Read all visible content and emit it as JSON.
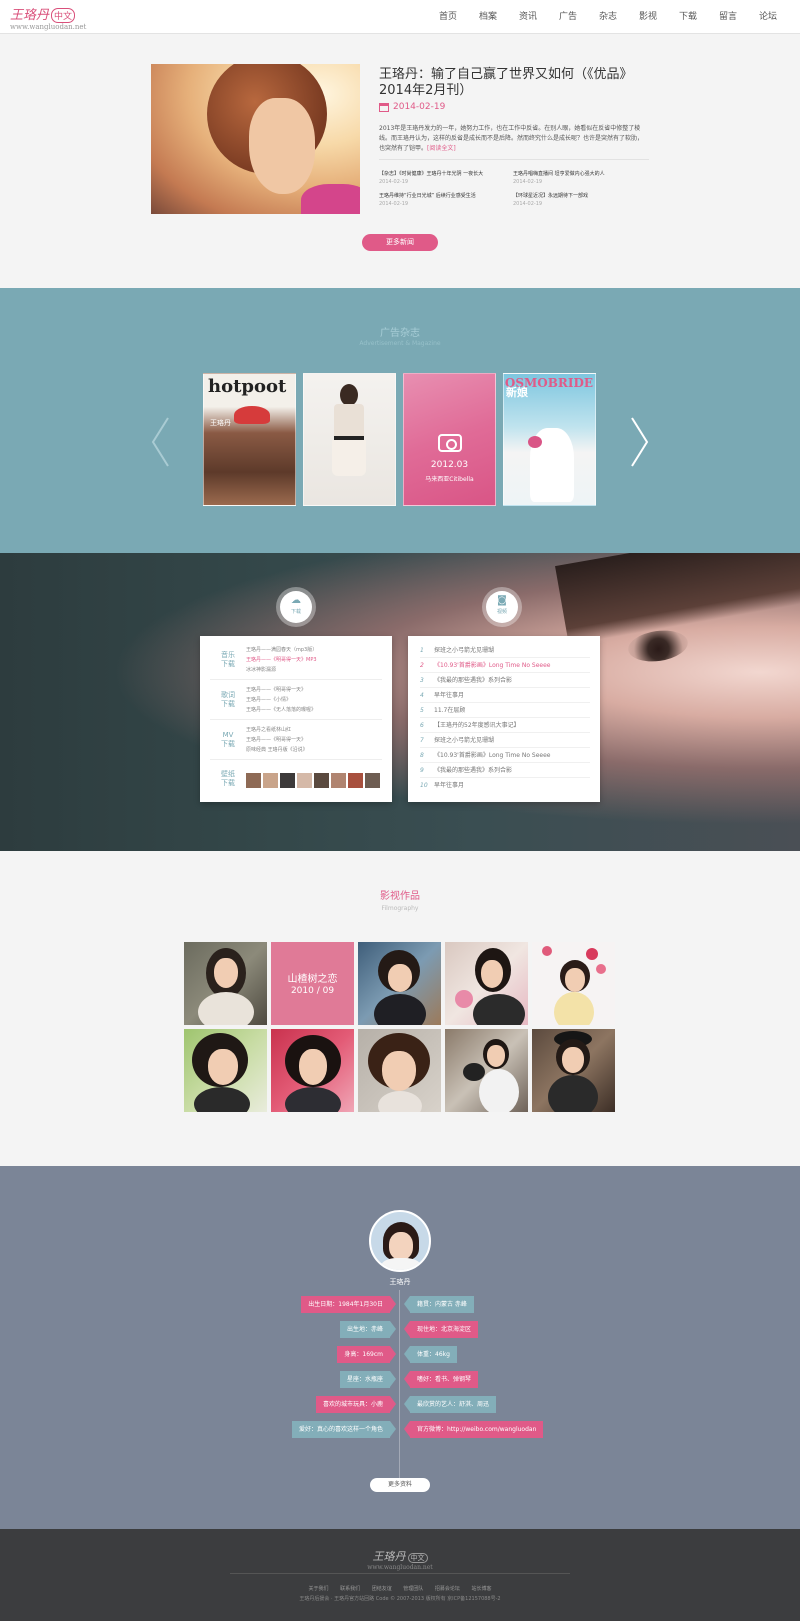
{
  "nav": {
    "logo_cn": "王珞丹",
    "logo_badge": "中文",
    "logo_en": "www.wangluodan.net",
    "items": [
      "首页",
      "档案",
      "资讯",
      "广告",
      "杂志",
      "影视",
      "下载",
      "留言",
      "论坛"
    ]
  },
  "news": {
    "title": "王珞丹：输了自己赢了世界又如何（《优品》2014年2月刊）",
    "date": "2014-02-19",
    "desc": "2013年是王珞丹发力的一年，她努力工作，也在工作中反省。在别人眼，她看似在反省中修整了棱线。而王珞丹认为，这样的反省是成长而不是后降。然而终究什么是成长呢？也许是突然有了软肋，也突然有了铠甲。",
    "read_more": "[阅读全文]",
    "sub_items": [
      {
        "title": "【杂志】《时尚健康》王珞丹十年光阴 一夜长大",
        "date": "2014-02-19"
      },
      {
        "title": "王珞丹唱嗨直播间 坦亨爱做内心强大的人",
        "date": "2014-02-19"
      },
      {
        "title": "王珞丹维持“行业日光城” 后续行业感受生活",
        "date": "2014-02-19"
      },
      {
        "title": "【环球星近况】永远期待下一部戏",
        "date": "2014-02-19"
      }
    ],
    "more_button": "更多新闻"
  },
  "magazines": {
    "title": "广告杂志",
    "subtitle": "Advertisement & Magazine",
    "items": [
      {
        "cover_title": "hotpoot",
        "side_text": "王珞丹"
      },
      {
        "cover_title": ""
      },
      {
        "issue": "2012.03",
        "caption": "马来西亚Citibella"
      },
      {
        "cover_title": "COSMOBRIDE",
        "cn": "新娘"
      }
    ]
  },
  "downloads": {
    "left_badge": "下载",
    "right_badge": "视频",
    "groups": [
      {
        "category": [
          "音乐",
          "下载"
        ],
        "links": [
          "王珞丹——满园春天（mp3版）",
          "王珞丹——《明哥得一天》MP3",
          "冰冰神影漏源"
        ]
      },
      {
        "category": [
          "歌词",
          "下载"
        ],
        "links": [
          "王珞丹——《明哥得一天》",
          "王珞丹——《小情》",
          "王珞丹——《无人落落的曝喔》"
        ]
      },
      {
        "category": [
          "MV",
          "下载"
        ],
        "links": [
          "王珞丹之看纸林山红",
          "王珞丹——《明哥得一天》",
          "原味经典 王珞丹版《沿说》"
        ]
      },
      {
        "category": [
          "壁纸",
          "下载"
        ],
        "links": []
      }
    ],
    "ranking": [
      {
        "n": "1",
        "title": "探班之小弓箭尤见珊瑚"
      },
      {
        "n": "2",
        "title": "《10.93'首爵影画》Long Time No Seeee"
      },
      {
        "n": "3",
        "title": "《我最的那些遇我》系列合影"
      },
      {
        "n": "4",
        "title": "早年往事月"
      },
      {
        "n": "5",
        "title": "11.7在层顾"
      },
      {
        "n": "6",
        "title": "【王珞丹的52年度感讯大事记】"
      },
      {
        "n": "7",
        "title": "探班之小弓箭尤见珊瑚"
      },
      {
        "n": "8",
        "title": "《10.93'首爵影画》Long Time No Seeee"
      },
      {
        "n": "9",
        "title": "《我最的那些遇我》系列合影"
      },
      {
        "n": "10",
        "title": "早年往事月"
      }
    ]
  },
  "films": {
    "title": "影视作品",
    "subtitle": "Filmography",
    "feature_title": "山楂树之恋",
    "feature_date": "2010 / 09"
  },
  "profile": {
    "name": "王珞丹",
    "left_tags": [
      {
        "text": "出生日期：1984年1月30日",
        "color": "pink"
      },
      {
        "text": "出生地：赤峰",
        "color": "blue"
      },
      {
        "text": "身高：169cm",
        "color": "pink"
      },
      {
        "text": "星座：水瓶座",
        "color": "blue"
      },
      {
        "text": "喜欢的城市玩具：小鹿",
        "color": "pink"
      },
      {
        "text": "爱好：真心的喜欢这样一个角色",
        "color": "blue"
      }
    ],
    "right_tags": [
      {
        "text": "籍贯：内蒙古 赤峰",
        "color": "blue"
      },
      {
        "text": "现住地：北京海淀区",
        "color": "pink"
      },
      {
        "text": "体重：46kg",
        "color": "blue"
      },
      {
        "text": "嗜好：看书、弹钢琴",
        "color": "pink"
      },
      {
        "text": "最欣赏的艺人：舒淇、周迅",
        "color": "blue"
      },
      {
        "text": "官方微博：http://weibo.com/wangluodan",
        "color": "pink"
      }
    ],
    "more_button": "更多资料"
  },
  "footer": {
    "logo_cn": "王珞丹",
    "logo_badge": "中文",
    "logo_en": "www.wangluodan.net",
    "links": [
      "关于我们",
      "联系我们",
      "团结友谊",
      "管理团队",
      "招募会论坛",
      "站长博客"
    ],
    "copyright": "王珞丹后援会 · 王珞丹官方站回路 Code © 2007-2013 版权所有 京ICP备12157088号-2"
  },
  "colors": {
    "accent": "#e05a88",
    "teal": "#7aa9b4",
    "slate": "#7b8597",
    "footer": "#3c3d3f"
  }
}
